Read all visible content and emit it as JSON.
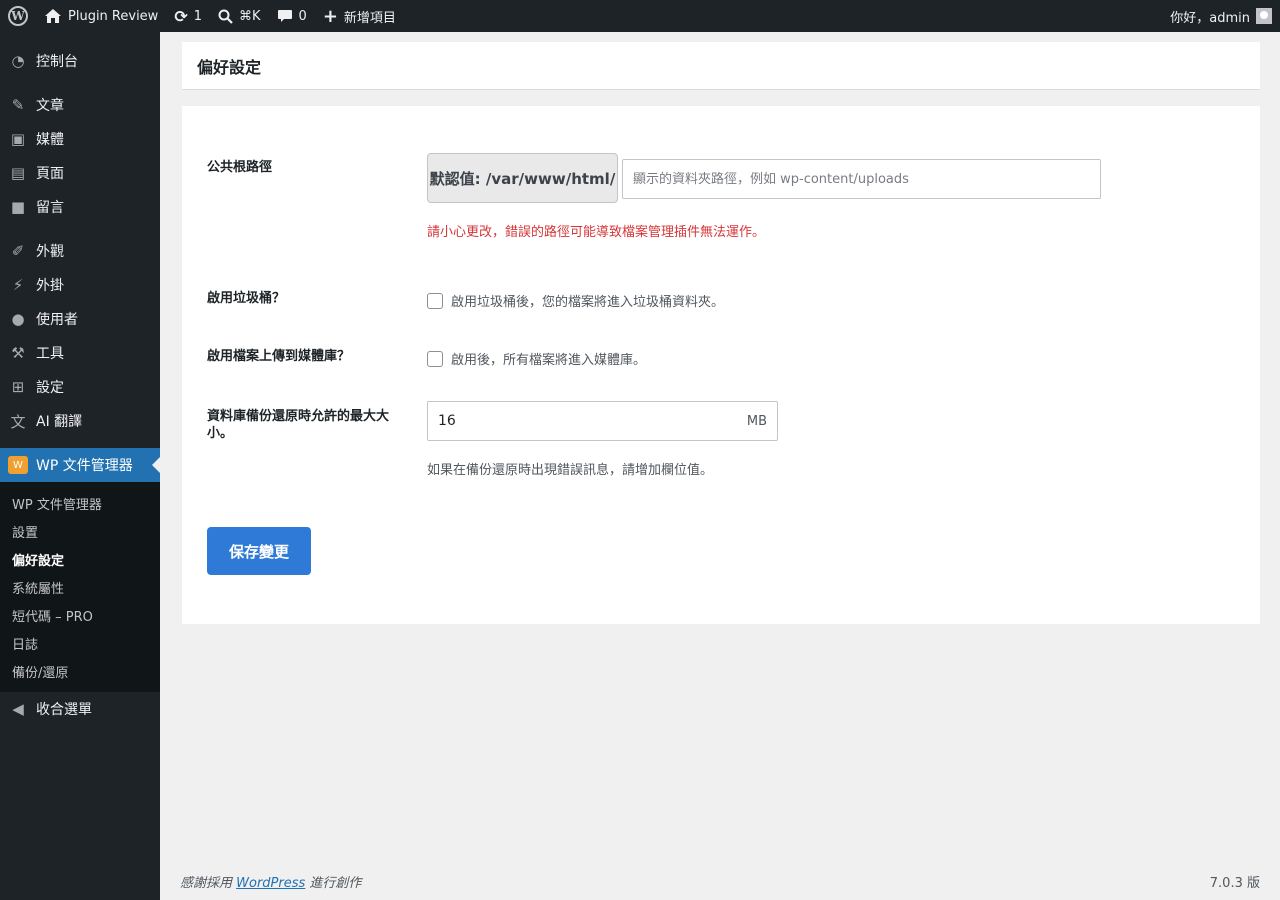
{
  "adminbar": {
    "site_name": "Plugin Review",
    "updates_count": "1",
    "search_shortcut": "⌘K",
    "comments_count": "0",
    "new_label": "新增項目",
    "greeting": "你好，admin"
  },
  "sidebar": {
    "items": [
      {
        "label": "控制台",
        "icon": "dashboard-icon"
      },
      {
        "label": "文章",
        "icon": "pin-icon"
      },
      {
        "label": "媒體",
        "icon": "media-icon"
      },
      {
        "label": "頁面",
        "icon": "page-icon"
      },
      {
        "label": "留言",
        "icon": "comment-icon"
      },
      {
        "label": "外觀",
        "icon": "brush-icon"
      },
      {
        "label": "外掛",
        "icon": "plugin-icon"
      },
      {
        "label": "使用者",
        "icon": "user-icon"
      },
      {
        "label": "工具",
        "icon": "wrench-icon"
      },
      {
        "label": "設定",
        "icon": "settings-icon"
      },
      {
        "label": "AI 翻譯",
        "icon": "translate-icon"
      }
    ],
    "current": {
      "label": "WP 文件管理器",
      "icon": "file-manager-icon"
    },
    "submenu": [
      "WP 文件管理器",
      "設置",
      "偏好設定",
      "系統屬性",
      "短代碼 – PRO",
      "日誌",
      "備份/還原"
    ],
    "collapse_label": "收合選單"
  },
  "page": {
    "title": "偏好設定",
    "public_root": {
      "label": "公共根路徑",
      "default_text": "默認值: /var/www/html/",
      "placeholder": "顯示的資料夾路徑，例如 wp-content/uploads",
      "warning": "請小心更改，錯誤的路徑可能導致檔案管理插件無法運作。"
    },
    "trash": {
      "label": "啟用垃圾桶？",
      "description": "啟用垃圾桶後，您的檔案將進入垃圾桶資料夾。"
    },
    "media_upload": {
      "label": "啟用檔案上傳到媒體庫？",
      "description": "啟用後，所有檔案將進入媒體庫。"
    },
    "max_size": {
      "label_line1": "資料庫備份還原時允許的最大大",
      "label_line2": "小。",
      "value": "16",
      "unit": "MB",
      "hint": "如果在備份還原時出現錯誤訊息，請增加欄位值。"
    },
    "save_label": "保存變更"
  },
  "footer": {
    "prefix": "感謝採用 ",
    "link": "WordPress",
    "suffix": " 進行創作",
    "version": "7.0.3 版"
  },
  "colors": {
    "accent": "#2271b1",
    "save_button": "#2f7ad6",
    "warning": "#d63638",
    "sidebar_bg": "#1d2327"
  }
}
